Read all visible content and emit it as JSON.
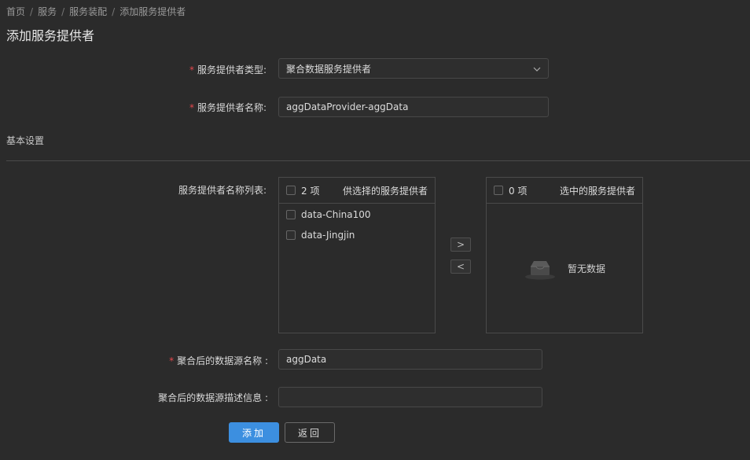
{
  "breadcrumb": [
    "首页",
    "服务",
    "服务装配",
    "添加服务提供者"
  ],
  "page_title": "添加服务提供者",
  "form": {
    "provider_type": {
      "label": "服务提供者类型:",
      "required": true,
      "value": "聚合数据服务提供者"
    },
    "provider_name": {
      "label": "服务提供者名称:",
      "required": true,
      "value": "aggDataProvider-aggData"
    },
    "section_title": "基本设置",
    "provider_list_label": "服务提供者名称列表:",
    "source_panel": {
      "count": "2 项",
      "title": "供选择的服务提供者",
      "items": [
        "data-China100",
        "data-Jingjin"
      ]
    },
    "target_panel": {
      "count": "0 项",
      "title": "选中的服务提供者",
      "empty_text": "暂无数据"
    },
    "move_right": ">",
    "move_left": "<",
    "agg_name": {
      "label": "聚合后的数据源名称 :",
      "required": true,
      "value": "aggData"
    },
    "agg_desc": {
      "label": "聚合后的数据源描述信息 :",
      "required": false,
      "value": ""
    }
  },
  "buttons": {
    "add": "添加",
    "back": "返回"
  },
  "colors": {
    "primary": "#3c8fe0",
    "required": "#e5484d",
    "background": "#2b2b2b"
  },
  "icons": {
    "select_chevron": "chevron-down-icon",
    "empty": "empty-inbox-icon"
  }
}
